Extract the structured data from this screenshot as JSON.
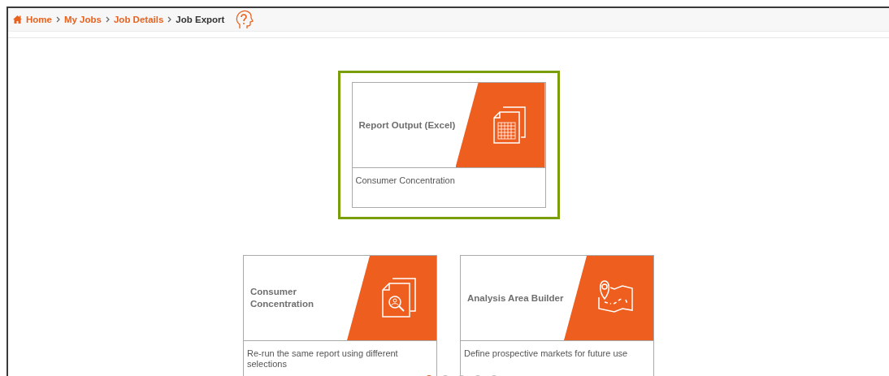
{
  "breadcrumbs": [
    {
      "label": "Home",
      "kind": "home"
    },
    {
      "label": "My Jobs",
      "kind": "link"
    },
    {
      "label": "Job Details",
      "kind": "link"
    },
    {
      "label": "Job Export",
      "kind": "current"
    }
  ],
  "featured": {
    "title": "Report Output (Excel)",
    "description": "Consumer Concentration",
    "kind": "spreadsheet",
    "selected": true
  },
  "cards": [
    {
      "title": "Consumer Concentration",
      "description": "Re-run the same report using different selections",
      "kind": "search-doc",
      "selected": false
    },
    {
      "title": "Analysis Area Builder",
      "description": "Define prospective markets for future use",
      "kind": "map",
      "selected": false
    }
  ],
  "pager": [
    {
      "selected": true
    },
    {
      "selected": false
    },
    {
      "selected": false
    },
    {
      "selected": false
    },
    {
      "selected": false
    }
  ]
}
